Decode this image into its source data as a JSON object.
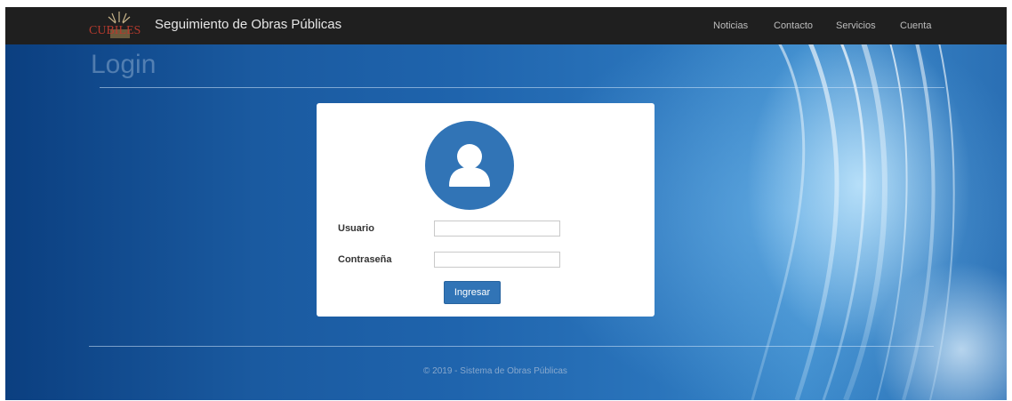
{
  "navbar": {
    "brand": "Seguimiento de Obras Públicas",
    "logo_text": "CUBILES",
    "items": [
      "Noticias",
      "Contacto",
      "Servicios",
      "Cuenta"
    ]
  },
  "page": {
    "title": "Login"
  },
  "login": {
    "avatar_icon": "user-icon",
    "username_label": "Usuario",
    "username_value": "",
    "password_label": "Contraseña",
    "password_value": "",
    "submit_label": "Ingresar"
  },
  "footer": {
    "text": "© 2019 - Sistema de Obras Públicas"
  },
  "colors": {
    "navbar_bg": "#1f1f1f",
    "accent": "#3174b6",
    "background": "#1f64ad"
  }
}
